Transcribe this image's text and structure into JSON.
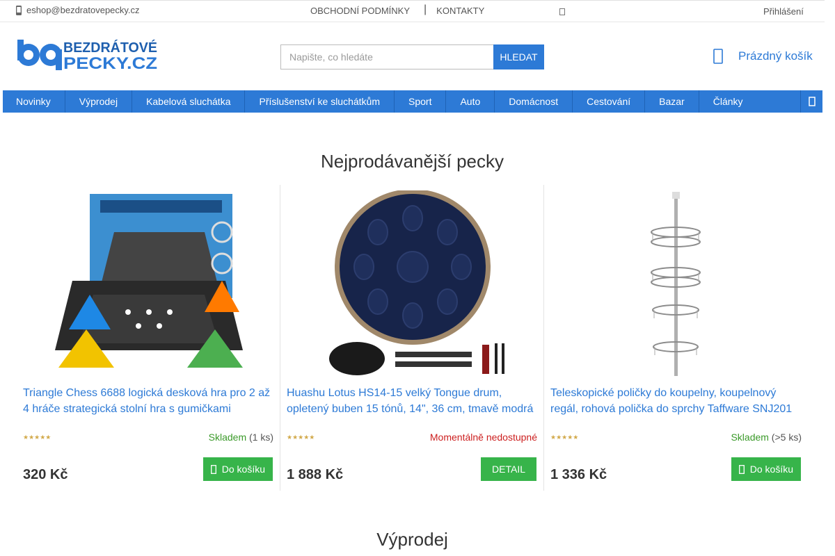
{
  "topbar": {
    "email": "eshop@bezdratovepecky.cz",
    "links": [
      "OBCHODNÍ PODMÍNKY",
      "KONTAKTY"
    ],
    "separator": "|",
    "login": "Přihlášení"
  },
  "header": {
    "logo_line1": "BEZDRÁTOVÉ",
    "logo_line2": "PECKY.CZ",
    "search_placeholder": "Napište, co hledáte",
    "search_button": "HLEDAT",
    "cart_label": "Prázdný košík"
  },
  "nav": {
    "items": [
      "Novinky",
      "Výprodej",
      "Kabelová sluchátka",
      "Příslušenství ke sluchátkům",
      "Sport",
      "Auto",
      "Domácnost",
      "Cestování",
      "Bazar",
      "Články"
    ]
  },
  "sections": {
    "bestsellers_title": "Nejprodávanější pecky",
    "sale_title": "Výprodej"
  },
  "products": [
    {
      "name": "Triangle Chess 6688 logická desková hra pro 2 až 4 hráče strategická stolní hra s gumičkami",
      "stars": "★★★★★",
      "availability_status": "Skladem",
      "availability_qty": " (1 ks)",
      "price": "320 Kč",
      "button": "Do košíku"
    },
    {
      "name": "Huashu Lotus HS14-15 velký Tongue drum, opletený buben 15 tónů, 14\", 36 cm, tmavě modrá",
      "stars": "★★★★★",
      "availability_status": "Momentálně nedostupné",
      "availability_qty": "",
      "price": "1 888 Kč",
      "button": "DETAIL"
    },
    {
      "name": "Teleskopické poličky do koupelny, koupelnový regál, rohová polička do sprchy Taffware SNJ201",
      "stars": "★★★★★",
      "availability_status": "Skladem",
      "availability_qty": " (>5 ks)",
      "price": "1 336 Kč",
      "button": "Do košíku"
    }
  ],
  "colors": {
    "primary": "#2d7ad6",
    "cta": "#37b44a",
    "in_stock": "#3b9a2a",
    "out_of_stock": "#cc1f1f"
  }
}
